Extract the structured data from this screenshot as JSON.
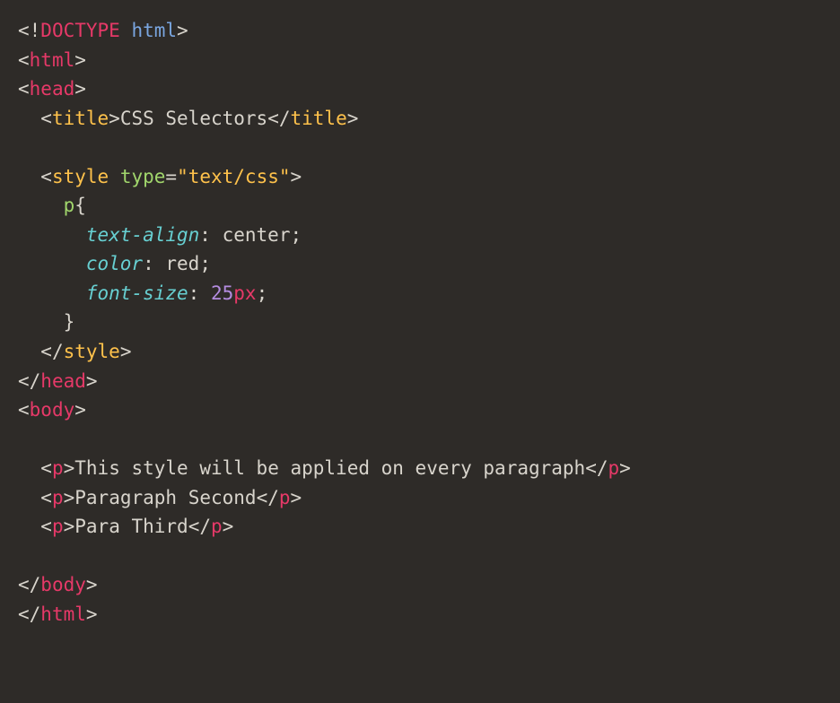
{
  "code": {
    "line1": {
      "doctype": "DOCTYPE",
      "html": "html"
    },
    "line2": {
      "tag": "html"
    },
    "line3": {
      "tag": "head"
    },
    "line4": {
      "tag": "title",
      "text": "CSS Selectors",
      "close": "title"
    },
    "line5": {
      "tag": "style",
      "attrName": "type",
      "attrVal": "\"text/css\""
    },
    "line6": {
      "selector": "p"
    },
    "line7": {
      "prop": "text-align",
      "value": "center"
    },
    "line8": {
      "prop": "color",
      "value": "red"
    },
    "line9": {
      "prop": "font-size",
      "num": "25",
      "unit": "px"
    },
    "line11": {
      "closeTag": "style"
    },
    "line12": {
      "closeTag": "head"
    },
    "line13": {
      "tag": "body"
    },
    "line14": {
      "tag": "p",
      "text": "This style will be applied on every paragraph",
      "close": "p"
    },
    "line15": {
      "tag": "p",
      "text": "Paragraph Second",
      "close": "p"
    },
    "line16": {
      "tag": "p",
      "text": "Para Third",
      "close": "p"
    },
    "line17": {
      "closeTag": "body"
    },
    "line18": {
      "closeTag": "html"
    }
  }
}
